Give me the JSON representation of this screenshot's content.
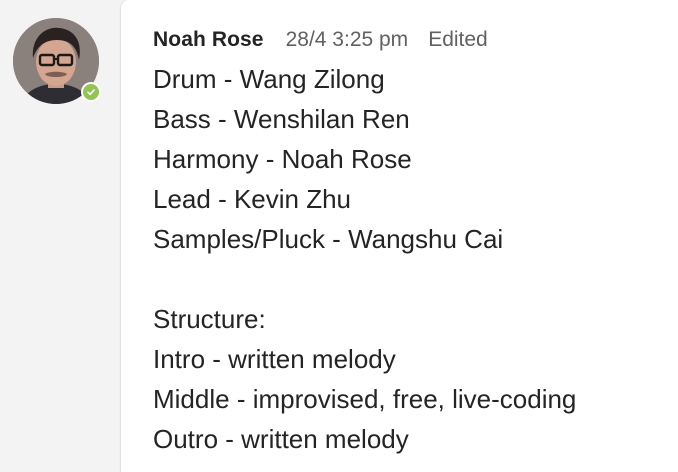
{
  "message": {
    "author": "Noah Rose",
    "timestamp": "28/4 3:25 pm",
    "edited_label": "Edited",
    "lines": [
      "Drum - Wang Zilong",
      "Bass - Wenshilan Ren",
      "Harmony - Noah Rose",
      "Lead - Kevin Zhu",
      "Samples/Pluck - Wangshu Cai",
      "",
      "Structure:",
      "Intro - written melody",
      "Middle - improvised, free, live-coding",
      "Outro - written melody"
    ]
  },
  "avatar": {
    "presence": "available",
    "presence_color": "#92c353",
    "icon": "checkmark-icon"
  }
}
